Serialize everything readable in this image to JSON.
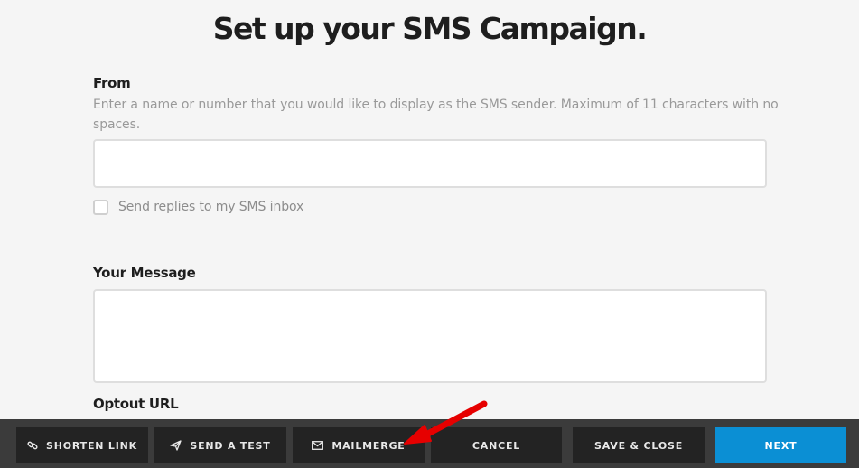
{
  "header": {
    "title": "Set up your SMS Campaign."
  },
  "from": {
    "label": "From",
    "help": "Enter a name or number that you would like to display as the SMS sender. Maximum of 11 characters with no spaces.",
    "value": "",
    "reply_checkbox": {
      "label": "Send replies to my SMS inbox",
      "checked": false
    }
  },
  "message": {
    "label": "Your Message",
    "value": ""
  },
  "optout": {
    "label": "Optout URL"
  },
  "toolbar": {
    "shorten_link": "SHORTEN LINK",
    "send_test": "SEND A TEST",
    "mailmerge": "MAILMERGE",
    "cancel": "CANCEL",
    "save_close": "SAVE & CLOSE",
    "next": "NEXT"
  },
  "colors": {
    "primary": "#0b8fd4",
    "toolbar_bg": "#3b3b3b",
    "button_bg": "#232323",
    "annotation_arrow": "#e60000"
  },
  "icons": {
    "shorten_link": "link-icon",
    "send_test": "paper-plane-icon",
    "mailmerge": "envelope-icon",
    "annotation": "red-arrow-icon"
  }
}
